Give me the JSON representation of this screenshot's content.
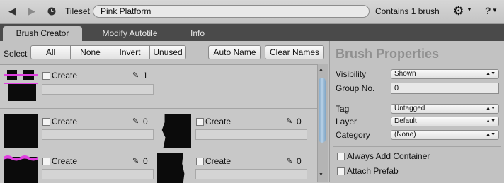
{
  "toolbar": {
    "back_icon": "back-arrow-icon",
    "forward_icon": "forward-arrow-icon",
    "history_icon": "history-clock-icon",
    "tileset_label": "Tileset",
    "tileset_value": "Pink Platform",
    "contains_text": "Contains 1 brush",
    "settings_icon": "gear-icon",
    "help_text": "?"
  },
  "tabs": [
    {
      "label": "Brush Creator",
      "active": true
    },
    {
      "label": "Modify Autotile",
      "active": false
    },
    {
      "label": "Info",
      "active": false
    }
  ],
  "select_bar": {
    "label": "Select",
    "segments": [
      "All",
      "None",
      "Invert",
      "Unused"
    ],
    "auto_name": "Auto Name",
    "clear_names": "Clear Names"
  },
  "brush_list": [
    {
      "create_label": "Create",
      "count": "1"
    },
    {
      "create_label": "Create",
      "count": "0"
    },
    {
      "create_label": "Create",
      "count": "0"
    },
    {
      "create_label": "Create",
      "count": "0"
    },
    {
      "create_label": "Create",
      "count": "0"
    }
  ],
  "brush_properties": {
    "title": "Brush Properties",
    "visibility_label": "Visibility",
    "visibility_value": "Shown",
    "group_label": "Group No.",
    "group_value": "0",
    "tag_label": "Tag",
    "tag_value": "Untagged",
    "layer_label": "Layer",
    "layer_value": "Default",
    "category_label": "Category",
    "category_value": "(None)",
    "always_add_container": "Always Add Container",
    "attach_prefab": "Attach Prefab"
  },
  "colors": {
    "accent_pink": "#e040e0",
    "tile_black": "#0b0b0b",
    "scroll_thumb": "#8fb2d0"
  }
}
